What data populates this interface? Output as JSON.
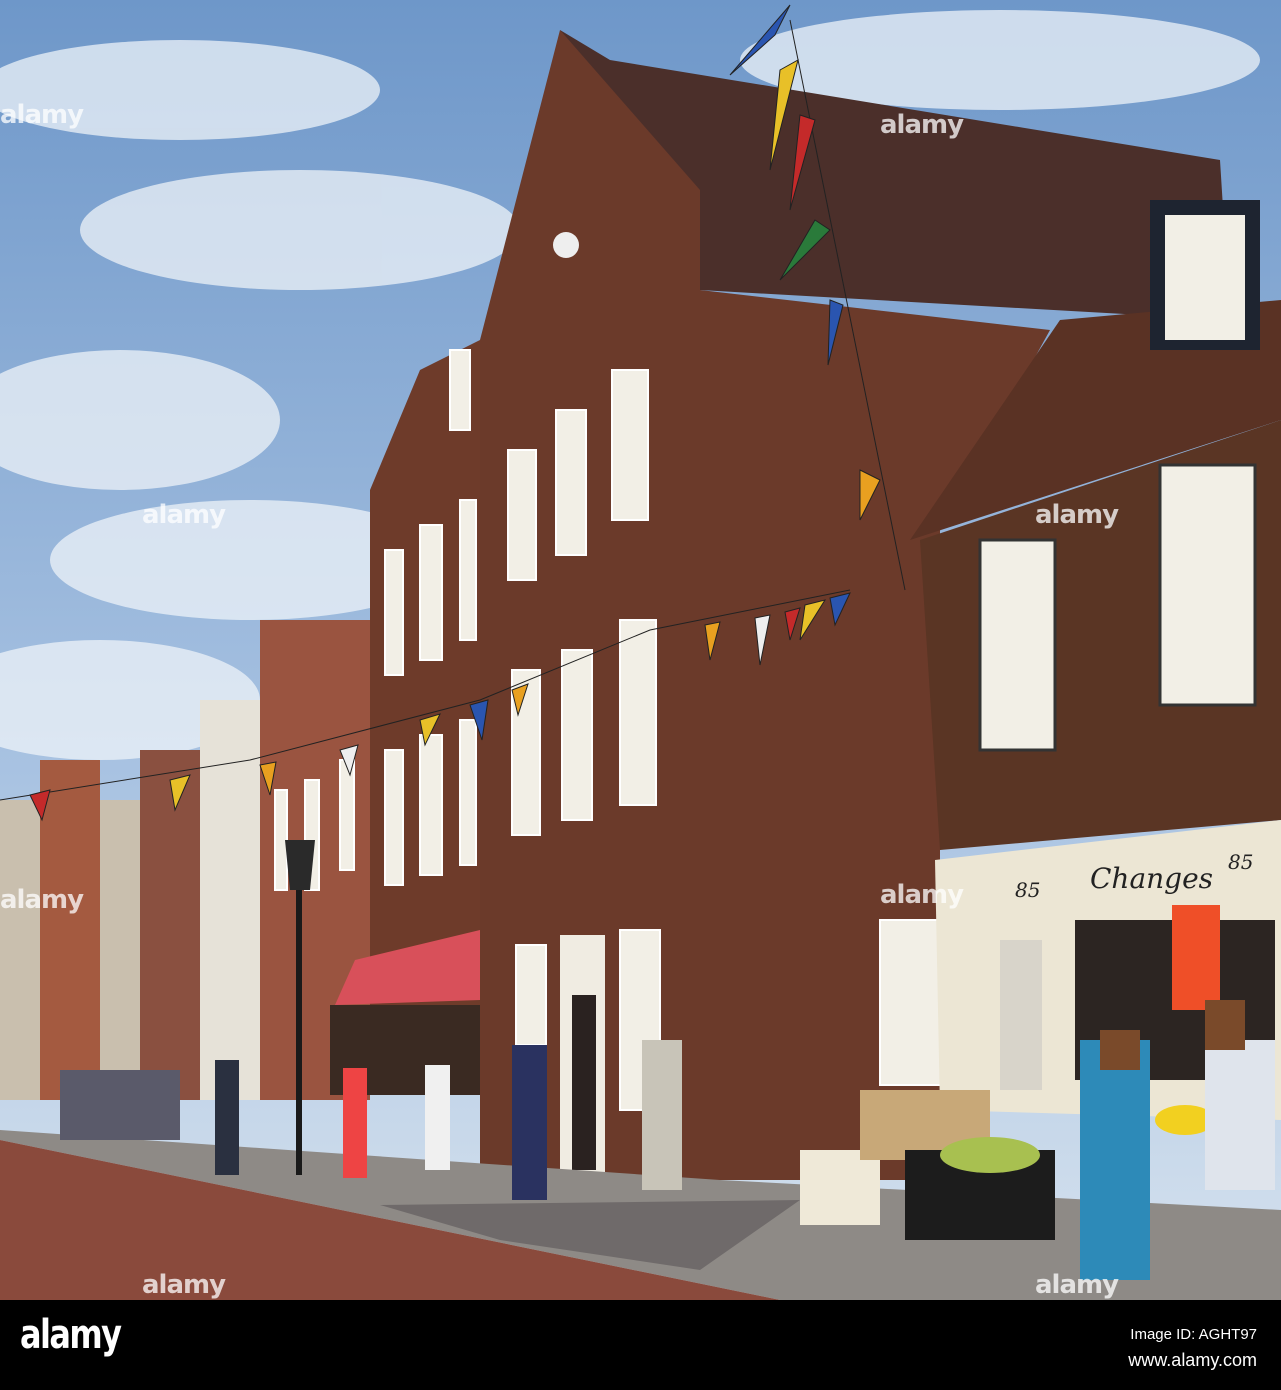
{
  "watermark": "alamy",
  "shop": {
    "name": "Changes",
    "number_left": "85",
    "number_right": "85"
  },
  "footer": {
    "logo": "alamy",
    "image_id": "Image ID: AGHT97",
    "url": "www.alamy.com"
  },
  "colors": {
    "sky": "#8fb3dc",
    "brick": "#6b3a2a",
    "roof": "#4a2e28",
    "timber": "#5a3524",
    "street": "#8a4a3c",
    "awning": "#d8505a"
  }
}
